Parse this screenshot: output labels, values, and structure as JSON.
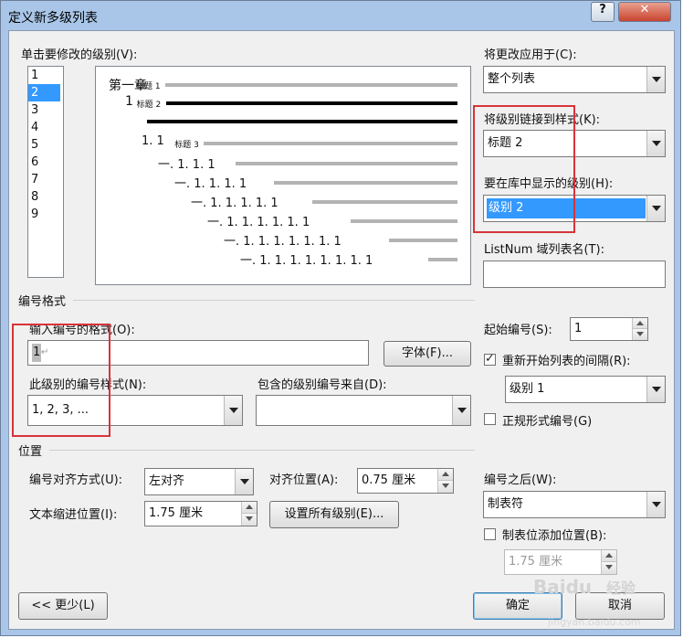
{
  "window": {
    "title": "定义新多级列表"
  },
  "levels": {
    "label": "单击要修改的级别(V):",
    "items": [
      "1",
      "2",
      "3",
      "4",
      "5",
      "6",
      "7",
      "8",
      "9"
    ],
    "selected": "2"
  },
  "preview": {
    "lines": [
      {
        "number": "第一章",
        "style": "标题 1"
      },
      {
        "number": "1",
        "style": "标题 2"
      },
      {
        "number": "1. 1",
        "style": "标题 3"
      },
      {
        "number": "一. 1. 1. 1"
      },
      {
        "number": "一. 1. 1. 1. 1"
      },
      {
        "number": "一. 1. 1. 1. 1. 1"
      },
      {
        "number": "一. 1. 1. 1. 1. 1. 1"
      },
      {
        "number": "一. 1. 1. 1. 1. 1. 1. 1"
      },
      {
        "number": "一. 1. 1. 1. 1. 1. 1. 1. 1"
      }
    ]
  },
  "apply_to": {
    "label": "将更改应用于(C):",
    "value": "整个列表"
  },
  "link_style": {
    "label": "将级别链接到样式(K):",
    "value": "标题 2"
  },
  "gallery_level": {
    "label": "要在库中显示的级别(H):",
    "value": "级别 2"
  },
  "listnum": {
    "label": "ListNum 域列表名(T):",
    "value": ""
  },
  "number_format": {
    "section": "编号格式",
    "format_label": "输入编号的格式(O):",
    "format_value": "1",
    "font_button": "字体(F)...",
    "style_label": "此级别的编号样式(N):",
    "style_value": "1, 2, 3, ...",
    "include_label": "包含的级别编号来自(D):",
    "include_value": ""
  },
  "start_at": {
    "label": "起始编号(S):",
    "value": "1"
  },
  "restart": {
    "label": "重新开始列表的间隔(R):",
    "checked": true,
    "value": "级别 1"
  },
  "legal": {
    "label": "正规形式编号(G)",
    "checked": false
  },
  "position": {
    "section": "位置",
    "align_label": "编号对齐方式(U):",
    "align_value": "左对齐",
    "align_at_label": "对齐位置(A):",
    "align_at_value": "0.75 厘米",
    "indent_label": "文本缩进位置(I):",
    "indent_value": "1.75 厘米",
    "set_all_button": "设置所有级别(E)..."
  },
  "follow": {
    "label": "编号之后(W):",
    "value": "制表符"
  },
  "tab_stop": {
    "label": "制表位添加位置(B):",
    "checked": false,
    "value": "1.75 厘米"
  },
  "buttons": {
    "less": "<< 更少(L)",
    "ok": "确定",
    "cancel": "取消"
  },
  "watermark": {
    "brand": "Baidu",
    "text": "经验",
    "url": "jingyan.baidu.com"
  },
  "titlebar": {
    "help": "?",
    "close": "✕"
  }
}
